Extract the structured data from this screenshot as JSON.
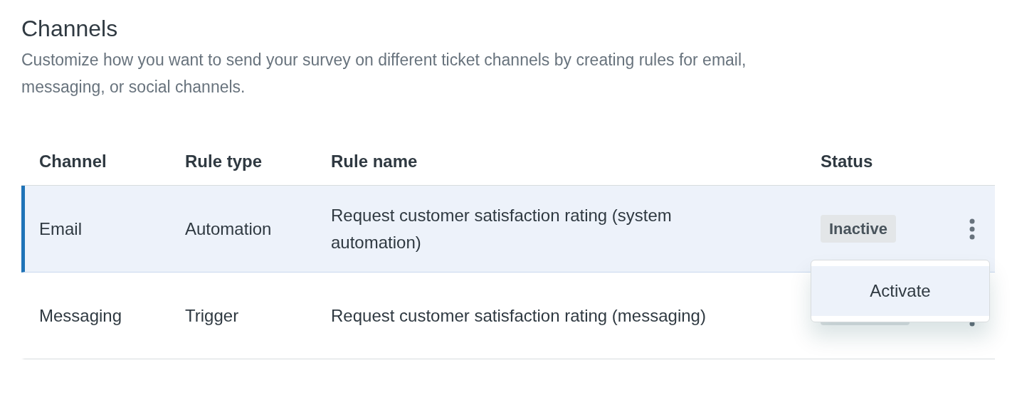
{
  "title": "Channels",
  "description": "Customize how you want to send your survey on different ticket channels by creating rules for email, messaging, or social channels.",
  "table": {
    "columns": [
      "Channel",
      "Rule type",
      "Rule name",
      "Status"
    ],
    "rows": [
      {
        "channel": "Email",
        "rule_type": "Automation",
        "rule_name": "Request customer satisfaction rating (system automation)",
        "status": "Inactive",
        "selected": true
      },
      {
        "channel": "Messaging",
        "rule_type": "Trigger",
        "rule_name": "Request customer satisfaction rating (messaging)",
        "selected": false
      }
    ]
  },
  "menu": {
    "items": [
      {
        "label": "Activate",
        "selected": true
      }
    ]
  }
}
